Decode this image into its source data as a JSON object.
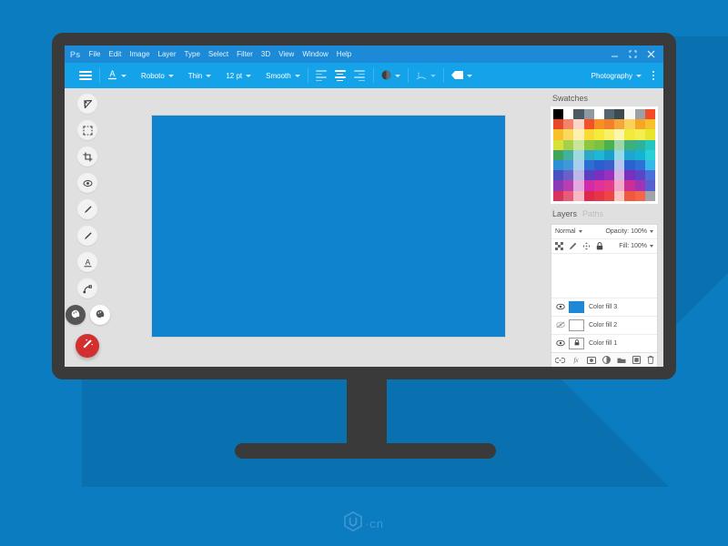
{
  "app": {
    "logo": "Ps",
    "background_color": "#0b7cc0",
    "shadow_color": "#0a71b0",
    "titlebar_color": "#1c8ad6",
    "optionsbar_color": "#14a3e8",
    "screen_bg": "#e0e0e0",
    "bezel_color": "#3a3a3a",
    "accent_color": "#d32f2f",
    "canvas_color": "#1083ce"
  },
  "titlebar": {
    "menus": [
      "File",
      "Edit",
      "Image",
      "Layer",
      "Type",
      "Select",
      "Filter",
      "3D",
      "View",
      "Window",
      "Help"
    ],
    "window_controls": [
      {
        "name": "minimize-button",
        "icon": "minimize-icon"
      },
      {
        "name": "maximize-button",
        "icon": "maximize-icon"
      },
      {
        "name": "close-button",
        "icon": "close-icon"
      }
    ]
  },
  "options_bar": {
    "menu_icon": "hamburger-icon",
    "text_color_icon": "text-color-icon",
    "font_family": "Roboto",
    "font_weight": "Thin",
    "font_size": "12 pt",
    "antialias": "Smooth",
    "align": [
      {
        "name": "align-left-button",
        "active": false
      },
      {
        "name": "align-center-button",
        "active": true
      },
      {
        "name": "align-right-button",
        "active": false
      }
    ],
    "color_swatch_icon": "color-circle-icon",
    "warp_icon": "warp-text-icon",
    "shape_icon": "shape-icon",
    "workspace": "Photography",
    "overflow_icon": "kebab-menu-icon"
  },
  "tools": [
    {
      "name": "move-tool",
      "icon": "arrow-cursor-icon"
    },
    {
      "name": "marquee-tool",
      "icon": "marquee-select-icon"
    },
    {
      "name": "crop-tool",
      "icon": "crop-icon"
    },
    {
      "name": "eyedropper-tool",
      "icon": "eyedropper-icon"
    },
    {
      "name": "brush-tool",
      "icon": "brush-icon"
    },
    {
      "name": "pencil-tool",
      "icon": "pencil-icon"
    },
    {
      "name": "type-tool",
      "icon": "type-a-icon"
    },
    {
      "name": "pen-tool",
      "icon": "pen-path-icon"
    }
  ],
  "color_swatches": {
    "foreground": "#555555",
    "background": "#ffffff",
    "foreground_icon": "palette-icon",
    "background_icon": "palette-icon"
  },
  "fab": {
    "name": "magic-wand-fab",
    "icon": "magic-wand-icon",
    "color": "#d32f2f"
  },
  "swatches_panel": {
    "title": "Swatches",
    "colors": [
      "#000000",
      "#ffffff",
      "#4c5a63",
      "#8e9aa1",
      "#ffffff",
      "#53656e",
      "#3c4a52",
      "#f7f7f5",
      "#9aa0a3",
      "#f44a2a",
      "#e8472c",
      "#f4836a",
      "#fbd6c9",
      "#f4512a",
      "#f69024",
      "#f47f2a",
      "#f5a63b",
      "#fbd15a",
      "#f5a623",
      "#f7c12b",
      "#f8c02a",
      "#fbd95c",
      "#fdf1b0",
      "#fada34",
      "#f6ea3c",
      "#f9f06a",
      "#fcf7ad",
      "#f2ea3d",
      "#f4ef4e",
      "#e9e52c",
      "#d8e03a",
      "#a6cf4a",
      "#c9e59a",
      "#8ec63f",
      "#7cc242",
      "#4caf50",
      "#9fd6a8",
      "#3fb07a",
      "#2eb398",
      "#26c6c0",
      "#3fa45c",
      "#44b1a0",
      "#9fd8dd",
      "#2ea8c8",
      "#1fb6d8",
      "#18a0c8",
      "#96d9e8",
      "#1fa5cf",
      "#14b3d4",
      "#2ad0d8",
      "#2d8fd4",
      "#4098d8",
      "#a9cdef",
      "#2a6fd1",
      "#2b5fd0",
      "#3860cc",
      "#b6c6ee",
      "#2a63cf",
      "#2f70d6",
      "#35b8ea",
      "#4a52c0",
      "#6b5fc9",
      "#bcb7e6",
      "#5a3fc0",
      "#7b2fc2",
      "#9a30be",
      "#d7b5e6",
      "#7a2fbd",
      "#5a46c7",
      "#4a6fd8",
      "#8b3bb5",
      "#b93fb0",
      "#e3a8dd",
      "#d02ba8",
      "#e0339a",
      "#e43b88",
      "#f2a9c9",
      "#c92f96",
      "#a233b4",
      "#5a5fd0",
      "#d7355e",
      "#e85a7a",
      "#f6b9c4",
      "#e0294a",
      "#e8344a",
      "#ef4444",
      "#fbc7c2",
      "#f05a3c",
      "#f4654a",
      "#a0a4a6"
    ]
  },
  "layers_panel": {
    "tab_active": "Layers",
    "tab_inactive": "Paths",
    "blend_mode": "Normal",
    "opacity_label": "Opacity:",
    "opacity_value": "100%",
    "fill_label": "Fill:",
    "fill_value": "100%",
    "lock_icons": [
      {
        "name": "lock-transparent-pixels-icon"
      },
      {
        "name": "lock-image-pixels-icon"
      },
      {
        "name": "lock-position-icon"
      },
      {
        "name": "lock-all-icon"
      }
    ],
    "layers": [
      {
        "name": "Color fill 3",
        "visible": true,
        "thumb_color": "#1e88d8",
        "locked": false
      },
      {
        "name": "Color fill 2",
        "visible": false,
        "thumb_color": "#ffffff",
        "locked": false
      },
      {
        "name": "Color fill 1",
        "visible": true,
        "thumb_color": "#ffffff",
        "locked": true
      }
    ],
    "bottom_tools": [
      {
        "name": "link-layers-button",
        "icon": "link-icon"
      },
      {
        "name": "layer-style-button",
        "icon": "fx-icon"
      },
      {
        "name": "layer-mask-button",
        "icon": "mask-icon"
      },
      {
        "name": "adjustment-layer-button",
        "icon": "half-circle-icon"
      },
      {
        "name": "new-group-button",
        "icon": "folder-icon"
      },
      {
        "name": "new-layer-button",
        "icon": "new-layer-icon"
      },
      {
        "name": "delete-layer-button",
        "icon": "trash-icon"
      }
    ]
  },
  "watermark": {
    "logo": "UI",
    "text": "·cn"
  }
}
